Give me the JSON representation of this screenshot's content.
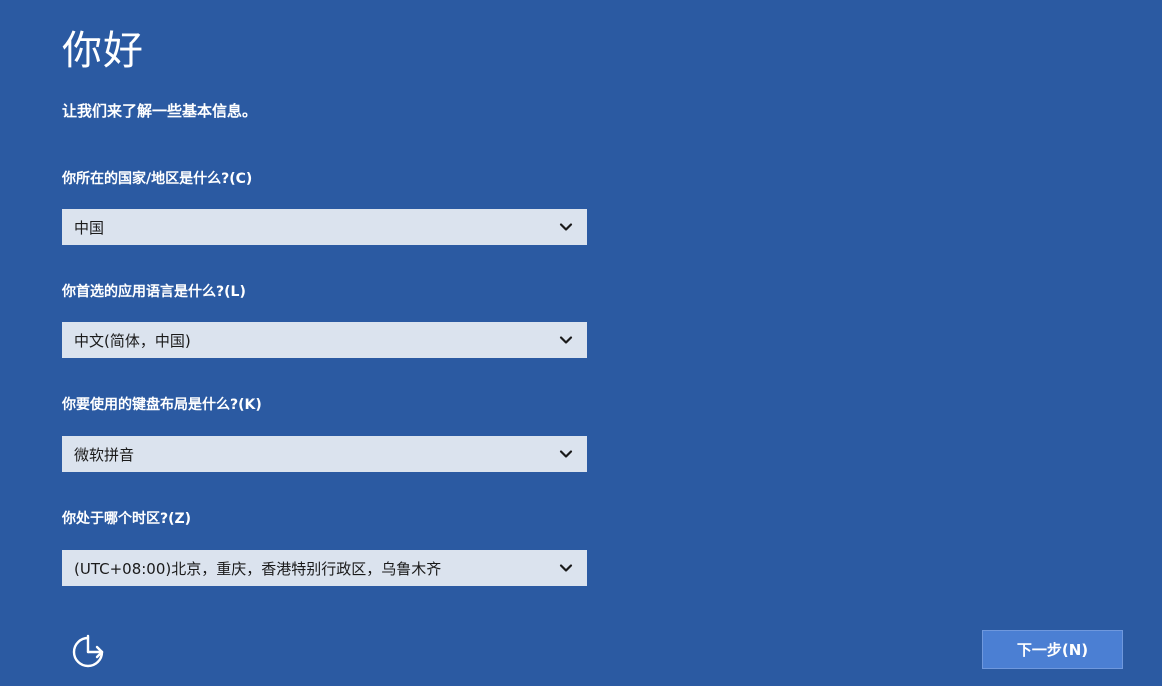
{
  "header": {
    "title": "你好",
    "subtitle": "让我们来了解一些基本信息。"
  },
  "fields": {
    "country": {
      "label": "你所在的国家/地区是什么?(C)",
      "value": "中国"
    },
    "app_language": {
      "label": "你首选的应用语言是什么?(L)",
      "value": "中文(简体，中国)"
    },
    "keyboard": {
      "label": "你要使用的键盘布局是什么?(K)",
      "value": "微软拼音"
    },
    "timezone": {
      "label": "你处于哪个时区?(Z)",
      "value": "(UTC+08:00)北京，重庆，香港特别行政区，乌鲁木齐"
    }
  },
  "footer": {
    "accessibility_icon": "ease-of-access-icon",
    "next_label": "下一步(N)"
  },
  "colors": {
    "background": "#2b5aa2",
    "select_background": "#dbe3ee",
    "button_background": "#4b7fd3"
  }
}
